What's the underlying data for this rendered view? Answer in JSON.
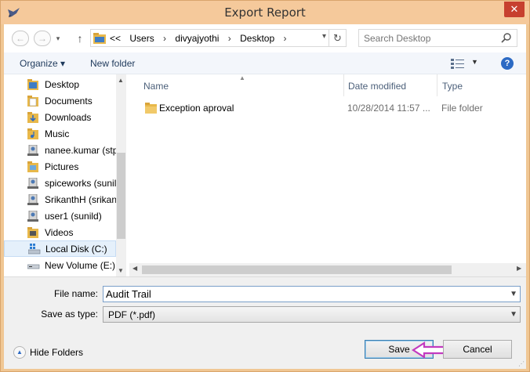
{
  "window": {
    "title": "Export Report",
    "close_label": "✕"
  },
  "address": {
    "overflow": "<<",
    "crumbs": [
      "Users",
      "divyajyothi",
      "Desktop"
    ],
    "separator": "›"
  },
  "search": {
    "placeholder": "Search Desktop"
  },
  "toolbar": {
    "organize_label": "Organize ▾",
    "new_folder_label": "New folder",
    "help_label": "?"
  },
  "nav": {
    "items": [
      {
        "label": "Desktop",
        "icon": "folder-icon"
      },
      {
        "label": "Documents",
        "icon": "folder-icon"
      },
      {
        "label": "Downloads",
        "icon": "folder-icon"
      },
      {
        "label": "Music",
        "icon": "folder-icon"
      },
      {
        "label": "nanee.kumar (stp",
        "icon": "network-user-icon"
      },
      {
        "label": "Pictures",
        "icon": "folder-icon"
      },
      {
        "label": "spiceworks (sunil",
        "icon": "network-user-icon"
      },
      {
        "label": "SrikanthH (srikan",
        "icon": "network-user-icon"
      },
      {
        "label": "user1 (sunild)",
        "icon": "network-user-icon"
      },
      {
        "label": "Videos",
        "icon": "folder-icon"
      },
      {
        "label": "Local Disk (C:)",
        "icon": "drive-icon"
      },
      {
        "label": "New Volume (E:)",
        "icon": "drive-icon"
      }
    ],
    "selected_index": 10
  },
  "files": {
    "columns": {
      "name": "Name",
      "date": "Date modified",
      "type": "Type"
    },
    "rows": [
      {
        "name": "Exception aproval",
        "date": "10/28/2014 11:57 ...",
        "type": "File folder"
      }
    ]
  },
  "form": {
    "filename_label": "File name:",
    "filename_value": "Audit Trail",
    "savetype_label": "Save as type:",
    "savetype_value": "PDF (*.pdf)",
    "hide_folders_label": "Hide Folders",
    "save_label": "Save",
    "cancel_label": "Cancel"
  },
  "colors": {
    "title_bg": "#f5c99b",
    "close_bg": "#c7402f",
    "annotation_arrow": "#c23ac0"
  }
}
